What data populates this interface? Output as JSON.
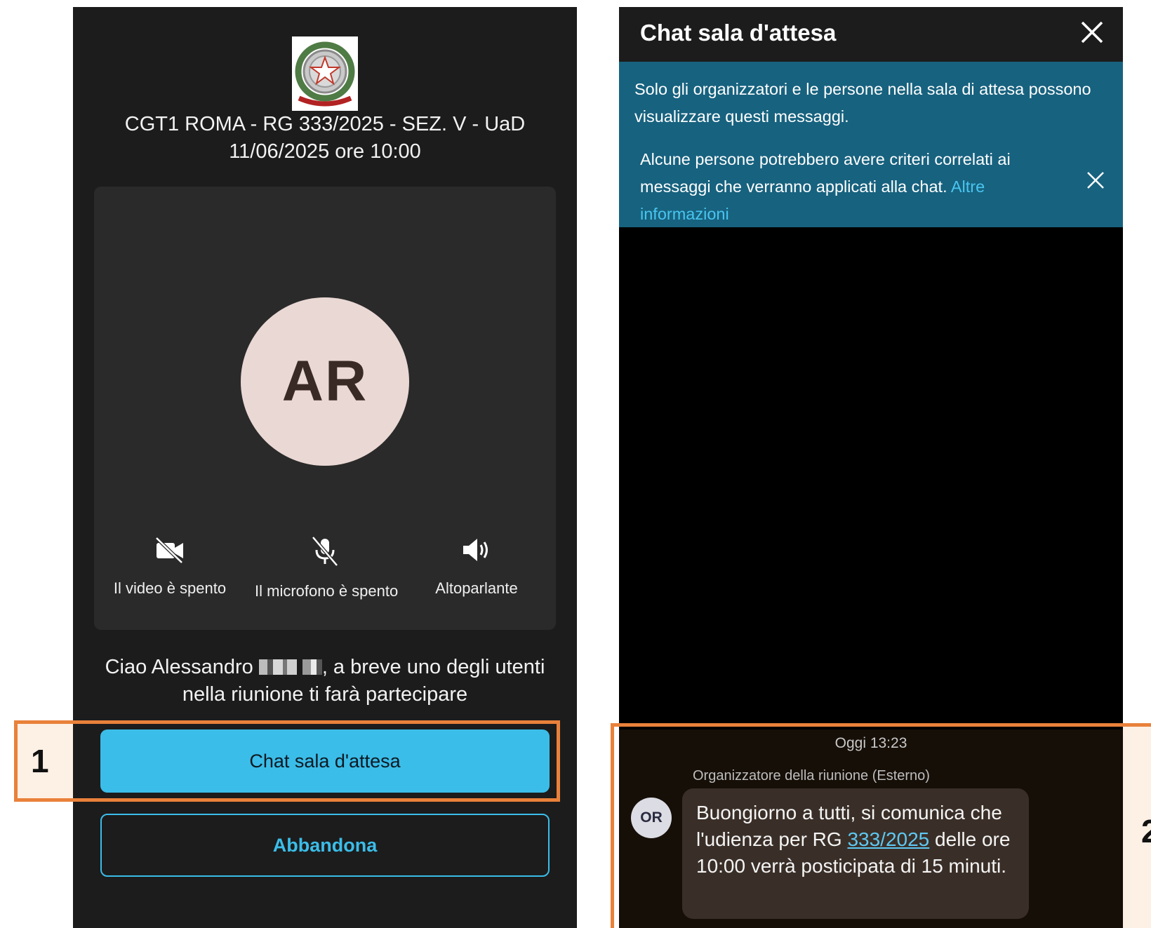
{
  "left_panel": {
    "meeting_title": "CGT1 ROMA - RG 333/2025 - SEZ. V - UaD 11/06/2025 ore 10:00",
    "avatar_initials": "AR",
    "controls": {
      "video": {
        "label": "Il video è spento",
        "icon": "video-off-icon"
      },
      "mic": {
        "label": "Il microfono è spento",
        "icon": "mic-off-icon"
      },
      "speaker": {
        "label": "Altoparlante",
        "icon": "speaker-icon"
      }
    },
    "welcome_before": "Ciao Alessandro",
    "welcome_after": ", a breve uno degli utenti nella riunione ti farà partecipare",
    "chat_button": "Chat sala d'attesa",
    "leave_button": "Abbandona"
  },
  "right_panel": {
    "header_title": "Chat sala d'attesa",
    "info_text_1": "Solo gli organizzatori e le persone nella sala di attesa possono visualizzare questi messaggi.",
    "info_text_2": "Alcune persone potrebbero avere criteri correlati ai messaggi che verranno applicati alla chat.",
    "info_link": "Altre informazioni",
    "timestamp": "Oggi 13:23",
    "sender": "Organizzatore della riunione (Esterno)",
    "sender_initials": "OR",
    "message_before": "Buongiorno a tutti, si comunica che l'udienza per RG",
    "message_link": "333/2025",
    "message_after": "delle ore 10:00 verrà posticipata di 15 minuti."
  },
  "annotations": {
    "label_1": "1",
    "label_2": "2"
  },
  "colors": {
    "accent": "#3bbde9",
    "highlight": "#e9813a",
    "banner": "#17627f"
  }
}
